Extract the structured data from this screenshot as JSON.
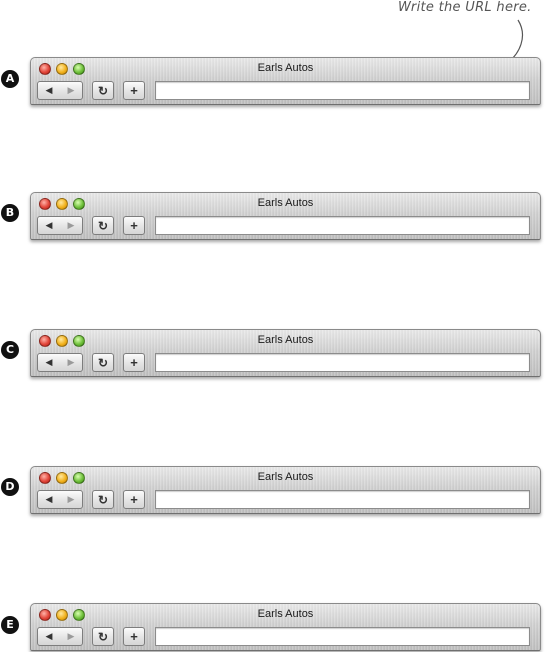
{
  "annotation": {
    "text": "Write the URL here."
  },
  "windows": [
    {
      "label": "A",
      "title": "Earls Autos",
      "url": ""
    },
    {
      "label": "B",
      "title": "Earls Autos",
      "url": ""
    },
    {
      "label": "C",
      "title": "Earls Autos",
      "url": ""
    },
    {
      "label": "D",
      "title": "Earls Autos",
      "url": ""
    },
    {
      "label": "E",
      "title": "Earls Autos",
      "url": ""
    }
  ],
  "toolbar": {
    "back_glyph": "◀",
    "forward_glyph": "▶",
    "reload_glyph": "↻",
    "add_glyph": "+"
  },
  "icons": {
    "back": "back-arrow-icon",
    "forward": "forward-arrow-icon",
    "reload": "reload-icon",
    "add": "add-icon"
  },
  "colors": {
    "close": "#e2463a",
    "minimize": "#f2b21d",
    "zoom": "#6fc03b"
  }
}
